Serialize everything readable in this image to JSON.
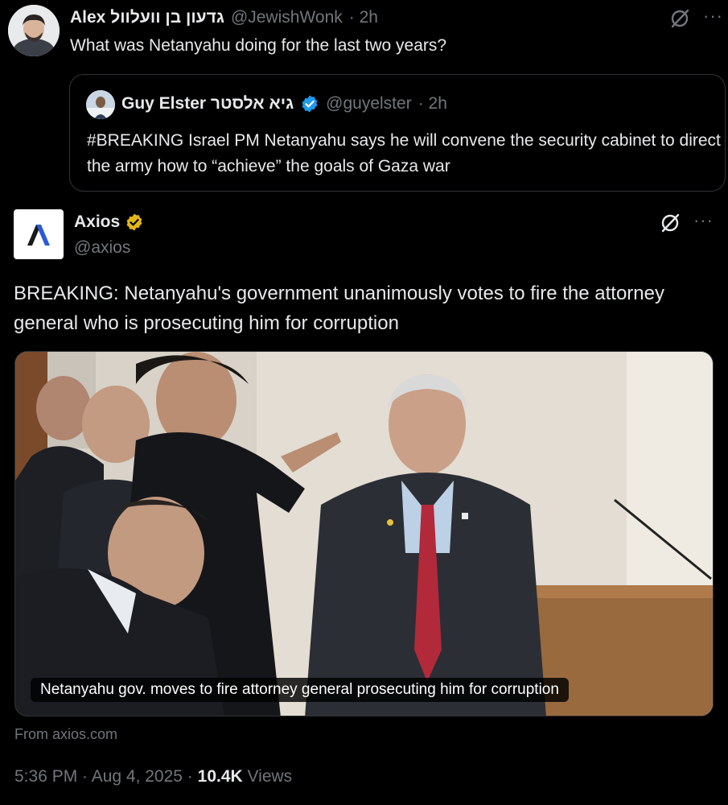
{
  "reply": {
    "name": "Alex גדעון בן וועלוול",
    "handle": "@JewishWonk",
    "time": "· 2h",
    "text": "What was Netanyahu doing for the last two years?",
    "more_label": "···"
  },
  "quoted": {
    "name": "Guy Elster גיא אלסטר",
    "handle": "@guyelster",
    "time": "· 2h",
    "text": "#BREAKING Israel PM Netanyahu says he will convene the security cabinet to direct the army how to “achieve” the goals of Gaza war"
  },
  "main": {
    "name": "Axios",
    "handle": "@axios",
    "more_label": "···",
    "text": "BREAKING: Netanyahu's government unanimously votes to fire the attorney general who is prosecuting him for corruption",
    "media_caption": "Netanyahu gov. moves to fire attorney general prosecuting him for corruption",
    "source": "From axios.com",
    "timestamp": "5:36 PM · Aug 4, 2025 ·",
    "views_count": "10.4K",
    "views_label": "Views"
  },
  "colors": {
    "background": "#000000",
    "text_primary": "#e7e9ea",
    "text_secondary": "#71767b",
    "verified_blue": "#1d9bf0",
    "verified_gold": "#e2b719",
    "border": "#2f3336"
  },
  "icons": [
    "grok-icon",
    "more-icon",
    "verified-blue-icon",
    "verified-gold-icon",
    "axios-logo"
  ]
}
